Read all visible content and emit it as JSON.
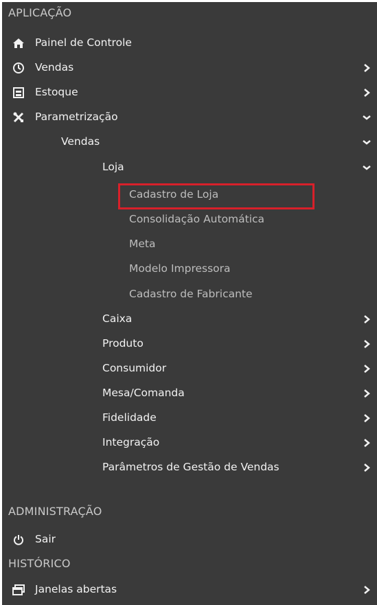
{
  "sections": {
    "aplicacao": "APLICAÇÃO",
    "administracao": "ADMINISTRAÇÃO",
    "historico": "HISTÓRICO"
  },
  "menu": {
    "painel": "Painel de Controle",
    "vendas": "Vendas",
    "estoque": "Estoque",
    "parametrizacao": "Parametrização",
    "param_vendas": "Vendas",
    "loja": "Loja",
    "cadastro_loja": "Cadastro de Loja",
    "consolidacao": "Consolidação Automática",
    "meta": "Meta",
    "modelo_impressora": "Modelo Impressora",
    "cadastro_fabricante": "Cadastro de Fabricante",
    "caixa": "Caixa",
    "produto": "Produto",
    "consumidor": "Consumidor",
    "mesa_comanda": "Mesa/Comanda",
    "fidelidade": "Fidelidade",
    "integracao": "Integração",
    "parametros_gestao": "Parâmetros de Gestão de Vendas",
    "sair": "Sair",
    "janelas_abertas": "Janelas abertas"
  },
  "icons": {
    "painel": "home-icon",
    "vendas": "sales-icon",
    "estoque": "inventory-icon",
    "parametrizacao": "tools-icon",
    "sair": "power-icon",
    "janelas": "windows-icon"
  },
  "colors": {
    "background": "#3a3a3a",
    "text": "#f2f2f2",
    "section": "#c9c9c9",
    "submenu": "#bdbdbd",
    "highlight": "#d8202a"
  }
}
